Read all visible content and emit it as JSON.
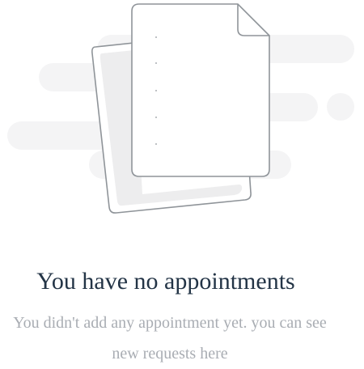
{
  "empty_state": {
    "title": "You have no appointments",
    "subtitle": "You didn't add any appointment yet. you can see new requests here",
    "illustration_icon": "empty-document-icon"
  },
  "colors": {
    "title": "#233446",
    "subtitle": "#a9adb3",
    "background_blobs": "#f4f4f5",
    "paper_border": "#8f9499",
    "paper_back_fill": "#ededee"
  }
}
